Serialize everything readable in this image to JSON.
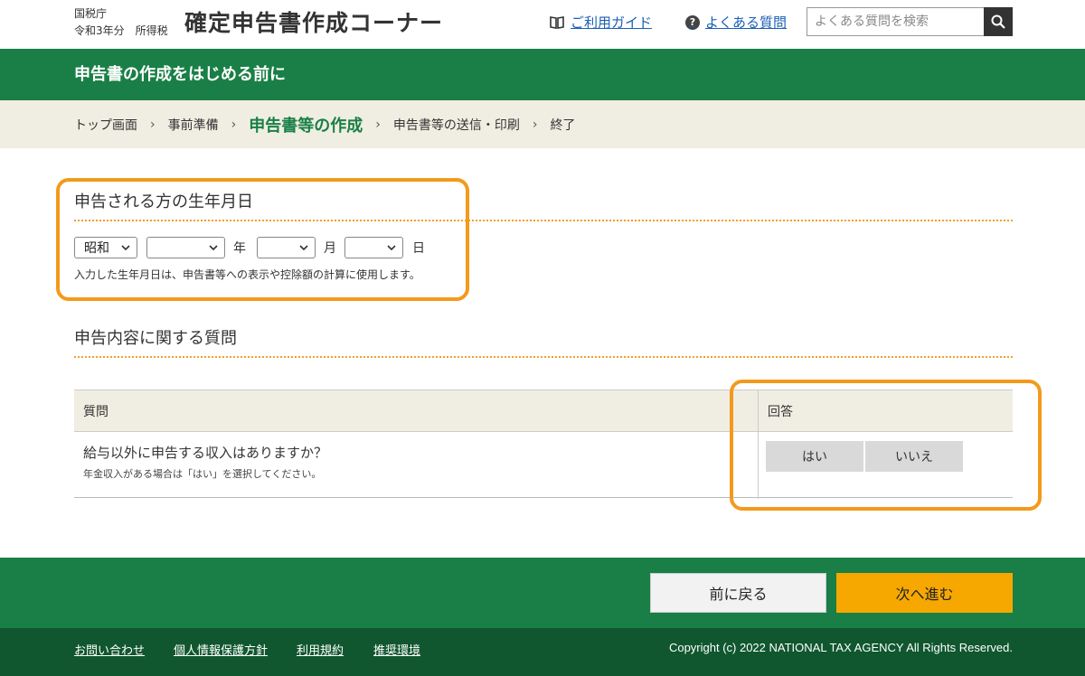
{
  "header": {
    "agency": "国税庁",
    "year_line": "令和3年分　所得税",
    "site_title": "確定申告書作成コーナー",
    "guide_link": "ご利用ガイド",
    "faq_link": "よくある質問",
    "search_placeholder": "よくある質問を検索"
  },
  "titlebar": {
    "title": "申告書の作成をはじめる前に"
  },
  "breadcrumb": {
    "items": [
      "トップ画面",
      "事前準備",
      "申告書等の作成",
      "申告書等の送信・印刷",
      "終了"
    ],
    "current_index": 2
  },
  "birthdate": {
    "title": "申告される方の生年月日",
    "era_value": "昭和",
    "year_value": "",
    "month_value": "",
    "day_value": "",
    "year_unit": "年",
    "month_unit": "月",
    "day_unit": "日",
    "note": "入力した生年月日は、申告書等への表示や控除額の計算に使用します。"
  },
  "questions": {
    "title": "申告内容に関する質問",
    "col_question": "質問",
    "col_answer": "回答",
    "rows": [
      {
        "question": "給与以外に申告する収入はありますか？",
        "sub": "年金収入がある場合は「はい」を選択してください。",
        "yes_label": "はい",
        "no_label": "いいえ"
      }
    ]
  },
  "footer_nav": {
    "back_label": "前に戻る",
    "next_label": "次へ進む"
  },
  "footer": {
    "links": [
      "お問い合わせ",
      "個人情報保護方針",
      "利用規約",
      "推奨環境"
    ],
    "copyright": "Copyright (c) 2022 NATIONAL TAX AGENCY All Rights Reserved."
  },
  "colors": {
    "brand_green": "#1a7f46",
    "footer_green": "#10572f",
    "accent_orange": "#f6a800",
    "highlight_orange": "#f39a1c",
    "breadcrumb_bg": "#f0eee2"
  },
  "icons": {
    "guide": "book-icon",
    "faq": "question-circle-icon",
    "search": "search-icon",
    "select": "chevron-down-icon",
    "breadcrumb_separator": "chevron-right-icon"
  }
}
